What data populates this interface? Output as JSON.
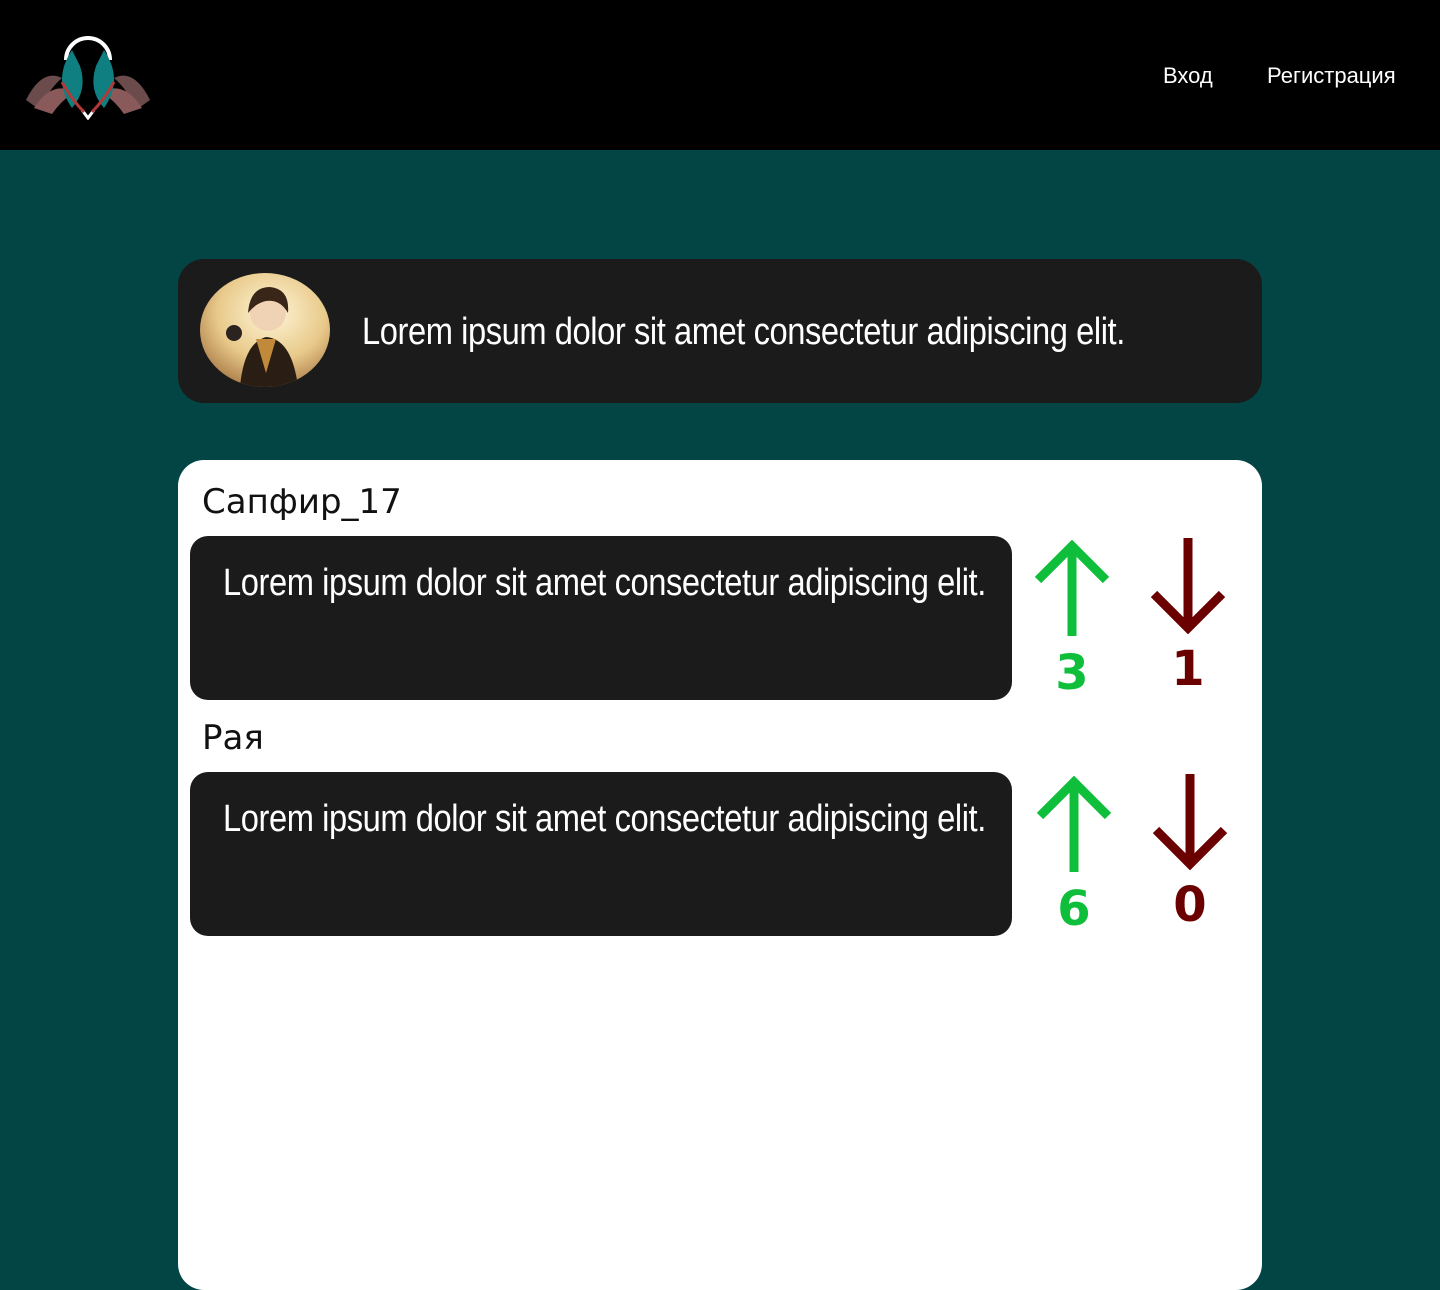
{
  "header": {
    "nav": {
      "login_label": "Вход",
      "register_label": "Регистрация"
    }
  },
  "post": {
    "text": "Lorem ipsum dolor sit amet consectetur adipiscing elit."
  },
  "comments": [
    {
      "author": "Сапфир_17",
      "text": "Lorem ipsum dolor sit amet consectetur adipiscing elit.",
      "upvotes": "3",
      "downvotes": "1"
    },
    {
      "author": "Рая",
      "text": "Lorem ipsum dolor sit amet consectetur adipiscing elit.",
      "upvotes": "6",
      "downvotes": "0"
    }
  ],
  "colors": {
    "page_background": "#034444",
    "header_background": "#000000",
    "card_background": "#1b1b1b",
    "upvote": "#0fbf3c",
    "downvote": "#6b0000"
  }
}
